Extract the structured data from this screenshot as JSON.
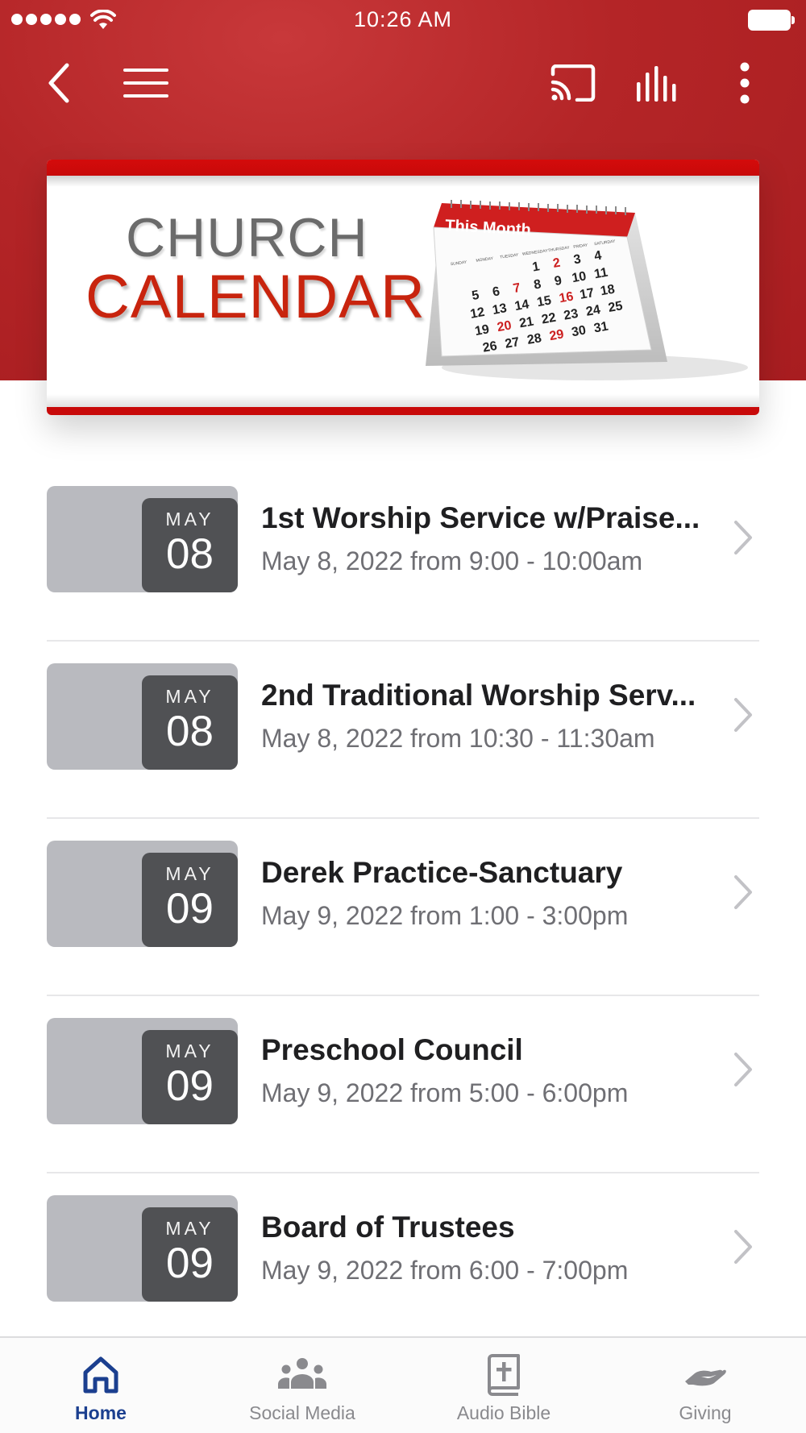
{
  "status_bar": {
    "time": "10:26 AM"
  },
  "toolbar": {
    "back_icon": "chevron-left-icon",
    "menu_icon": "hamburger-menu-icon",
    "cast_icon": "cast-icon",
    "audio_icon": "audio-bars-icon",
    "more_icon": "more-vertical-icon"
  },
  "banner": {
    "line1": "CHURCH",
    "line2": "CALENDAR",
    "calendar_heading": "This Month",
    "weekdays": [
      "SUNDAY",
      "MONDAY",
      "TUESDAY",
      "WEDNESDAY",
      "THURSDAY",
      "FRIDAY",
      "SATURDAY"
    ],
    "dates_row1": [
      "1",
      "2",
      "3",
      "4"
    ],
    "dates_row2": [
      "5",
      "6",
      "7",
      "8",
      "9",
      "10",
      "11"
    ],
    "dates_row3": [
      "12",
      "13",
      "14",
      "15",
      "16",
      "17",
      "18"
    ],
    "dates_row4": [
      "19",
      "20",
      "21",
      "22",
      "23",
      "24",
      "25"
    ],
    "dates_row5": [
      "26",
      "27",
      "28",
      "29",
      "30",
      "31"
    ],
    "accent_color": "#c8240e"
  },
  "events": [
    {
      "month": "MAY",
      "day": "08",
      "title": "1st Worship Service w/Praise...",
      "subtitle": "May 8, 2022 from 9:00 - 10:00am"
    },
    {
      "month": "MAY",
      "day": "08",
      "title": "2nd Traditional Worship Serv...",
      "subtitle": "May 8, 2022 from 10:30 - 11:30am"
    },
    {
      "month": "MAY",
      "day": "09",
      "title": "Derek Practice-Sanctuary",
      "subtitle": "May 9, 2022 from 1:00 - 3:00pm"
    },
    {
      "month": "MAY",
      "day": "09",
      "title": "Preschool Council",
      "subtitle": "May 9, 2022 from 5:00 - 6:00pm"
    },
    {
      "month": "MAY",
      "day": "09",
      "title": "Board of Trustees",
      "subtitle": "May 9, 2022 from 6:00 - 7:00pm"
    }
  ],
  "tabs": [
    {
      "label": "Home",
      "icon": "home-icon",
      "active": true
    },
    {
      "label": "Social Media",
      "icon": "people-group-icon",
      "active": false
    },
    {
      "label": "Audio Bible",
      "icon": "bible-book-icon",
      "active": false
    },
    {
      "label": "Giving",
      "icon": "giving-hand-icon",
      "active": false
    }
  ],
  "colors": {
    "header_red": "#b42527",
    "active_tab": "#1b3f8f",
    "inactive_tab": "#8a8a8e",
    "date_block_dark": "#505154",
    "date_block_light": "#b9babf"
  }
}
